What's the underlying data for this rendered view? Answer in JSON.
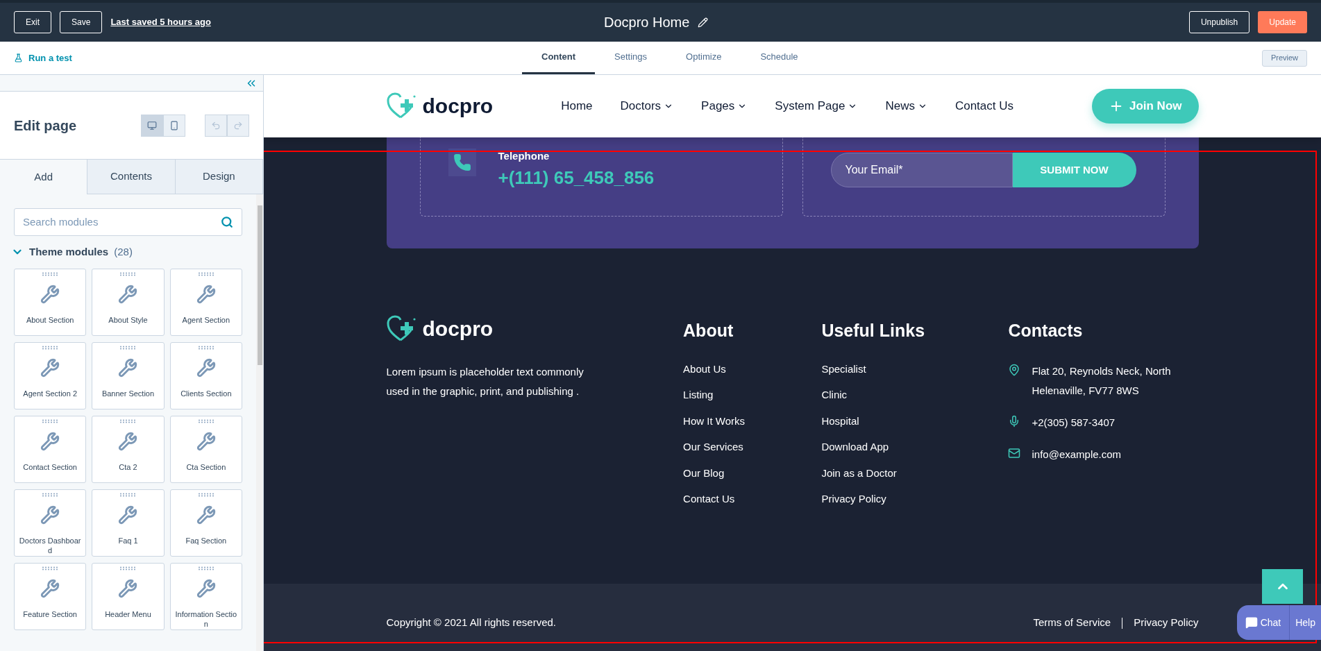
{
  "topbar": {
    "exit": "Exit",
    "save": "Save",
    "last_saved": "Last saved 5 hours ago",
    "title": "Docpro Home",
    "unpublish": "Unpublish",
    "update": "Update"
  },
  "subbar": {
    "run_test": "Run a test",
    "tabs": [
      {
        "label": "Content",
        "selected": true
      },
      {
        "label": "Settings",
        "selected": false
      },
      {
        "label": "Optimize",
        "selected": false
      },
      {
        "label": "Schedule",
        "selected": false
      }
    ],
    "preview": "Preview"
  },
  "sidebar": {
    "title": "Edit page",
    "views": [
      {
        "kind": "desktop",
        "selected": true
      },
      {
        "kind": "mobile",
        "selected": false
      }
    ],
    "tabs": [
      {
        "label": "Add",
        "selected": true
      },
      {
        "label": "Contents",
        "selected": false
      },
      {
        "label": "Design",
        "selected": false
      }
    ],
    "search": {
      "placeholder": "Search modules"
    },
    "section": {
      "title": "Theme modules",
      "count": "(28)",
      "expanded": true
    },
    "modules": [
      "About Section",
      "About Style",
      "Agent Section",
      "Agent Section 2",
      "Banner Section",
      "Clients Section",
      "Contact Section",
      "Cta 2",
      "Cta Section",
      "Doctors Dashboard",
      "Faq 1",
      "Faq Section",
      "Feature Section",
      "Header Menu",
      "Information Section"
    ]
  },
  "site_header": {
    "logo": "docpro",
    "nav": [
      {
        "label": "Home",
        "dropdown": false
      },
      {
        "label": "Doctors",
        "dropdown": true
      },
      {
        "label": "Pages",
        "dropdown": true
      },
      {
        "label": "System Page",
        "dropdown": true
      },
      {
        "label": "News",
        "dropdown": true
      },
      {
        "label": "Contact Us",
        "dropdown": false
      }
    ],
    "cta": "Join Now"
  },
  "contact_card": {
    "phone_label": "Telephone",
    "phone": "+(111) 65_458_856",
    "email_placeholder": "Your Email*",
    "submit": "SUBMIT NOW"
  },
  "footer": {
    "logo": "docpro",
    "description": "Lorem ipsum is placeholder text commonly used in the graphic, print, and publishing .",
    "columns": [
      {
        "title": "About",
        "links": [
          "About Us",
          "Listing",
          "How It Works",
          "Our Services",
          "Our Blog",
          "Contact Us"
        ]
      },
      {
        "title": "Useful Links",
        "links": [
          "Specialist",
          "Clinic",
          "Hospital",
          "Download App",
          "Join as a Doctor",
          "Privacy Policy"
        ]
      }
    ],
    "contacts": {
      "title": "Contacts",
      "items": [
        {
          "kind": "location",
          "text": "Flat 20, Reynolds Neck, North Helenaville, FV77 8WS"
        },
        {
          "kind": "phone",
          "text": "+2(305) 587-3407"
        },
        {
          "kind": "email",
          "text": "info@example.com"
        }
      ]
    }
  },
  "bottom_bar": {
    "copyright": "Copyright © 2021 All rights reserved.",
    "links": [
      "Terms of Service",
      "Privacy Policy"
    ]
  },
  "chat": {
    "chat": "Chat",
    "help": "Help"
  }
}
